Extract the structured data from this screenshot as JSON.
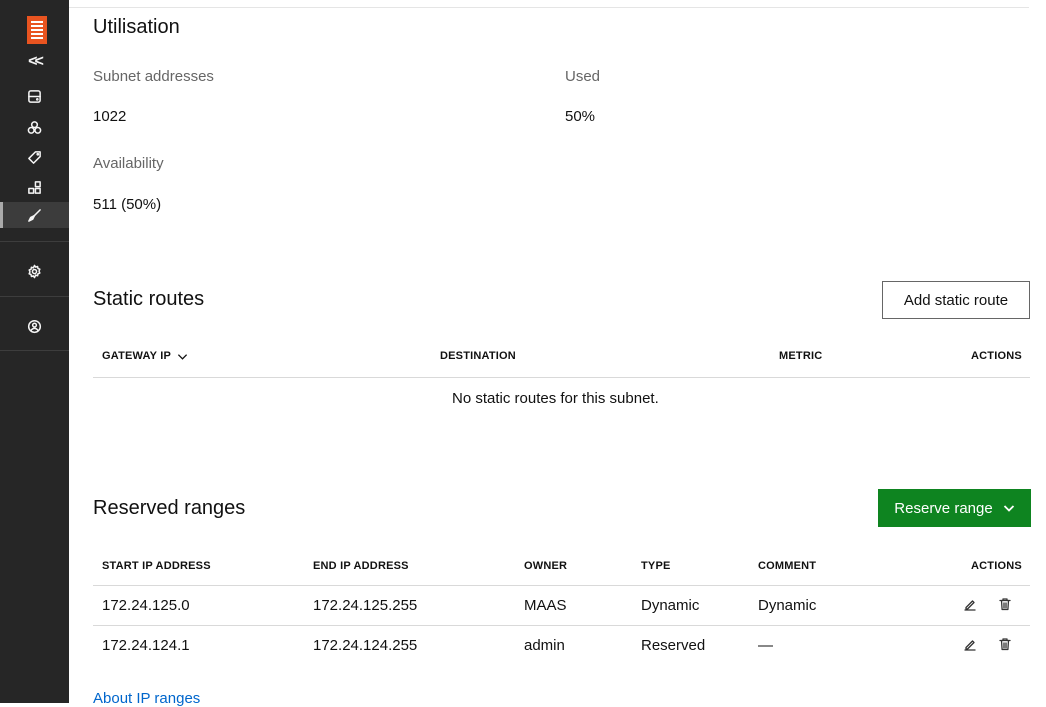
{
  "sidebar": {
    "logo_icon": "maas-logo-icon",
    "collapse_label": "<<",
    "items": [
      {
        "icon": "machines-icon"
      },
      {
        "icon": "pools-icon"
      },
      {
        "icon": "tags-icon"
      },
      {
        "icon": "zones-icon"
      },
      {
        "icon": "networking-icon",
        "active": true
      },
      {
        "icon": "settings-icon"
      },
      {
        "icon": "account-icon"
      }
    ]
  },
  "utilisation": {
    "title": "Utilisation",
    "subnet_addresses_label": "Subnet addresses",
    "subnet_addresses_value": "1022",
    "used_label": "Used",
    "used_value": "50%",
    "availability_label": "Availability",
    "availability_value": "511 (50%)"
  },
  "static_routes": {
    "title": "Static routes",
    "add_button": "Add static route",
    "columns": [
      "GATEWAY IP",
      "DESTINATION",
      "METRIC",
      "ACTIONS"
    ],
    "empty_message": "No static routes for this subnet."
  },
  "reserved_ranges": {
    "title": "Reserved ranges",
    "reserve_button": "Reserve range",
    "columns": [
      "START IP ADDRESS",
      "END IP ADDRESS",
      "OWNER",
      "TYPE",
      "COMMENT",
      "ACTIONS"
    ],
    "rows": [
      {
        "start": "172.24.125.0",
        "end": "172.24.125.255",
        "owner": "MAAS",
        "type": "Dynamic",
        "comment": "Dynamic"
      },
      {
        "start": "172.24.124.1",
        "end": "172.24.124.255",
        "owner": "admin",
        "type": "Reserved",
        "comment": "—"
      }
    ],
    "about_link": "About IP ranges"
  },
  "colors": {
    "sidebar_bg": "#262626",
    "brand_orange": "#e95420",
    "positive_green": "#0e8420",
    "link_blue": "#0066cc"
  }
}
